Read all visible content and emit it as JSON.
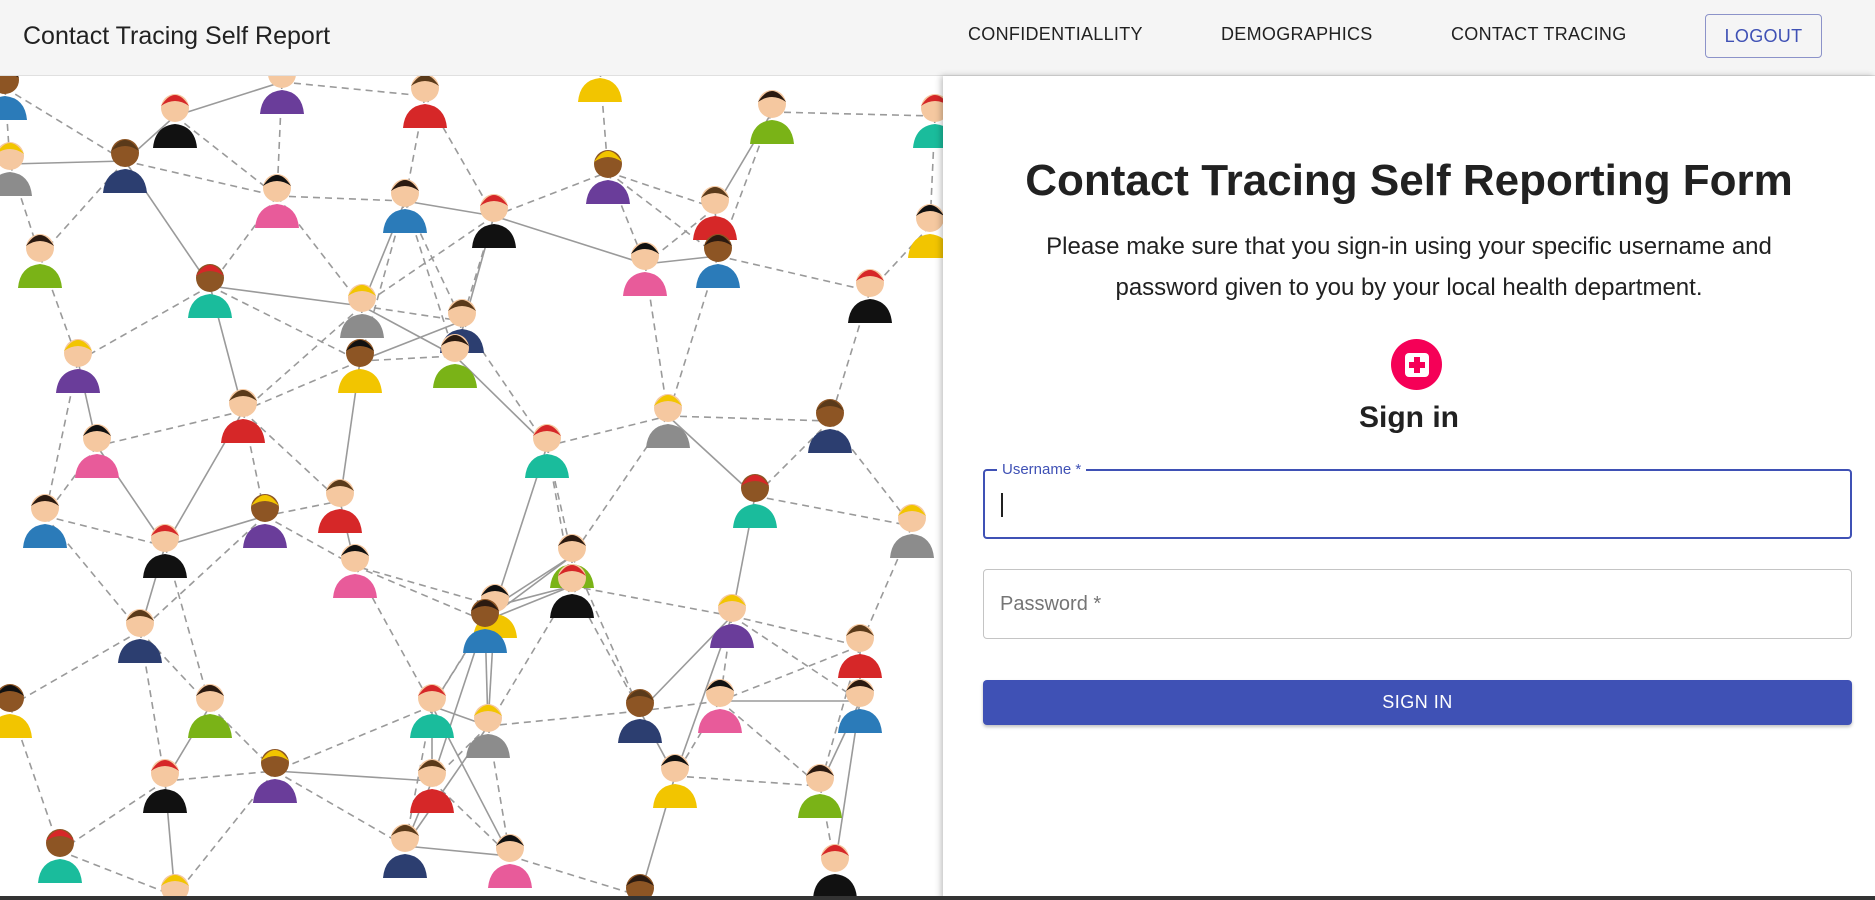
{
  "appbar": {
    "title": "Contact Tracing Self Report",
    "nav": [
      {
        "label": "CONFIDENTIALLITY"
      },
      {
        "label": "DEMOGRAPHICS"
      },
      {
        "label": "CONTACT TRACING"
      }
    ],
    "logout_label": "LOGOUT"
  },
  "form": {
    "title": "Contact Tracing Self Reporting Form",
    "description": "Please make sure that you sign-in using your specific username and password given to you by your local health department.",
    "avatar_icon": "medical-cross-icon",
    "signin_heading": "Sign in",
    "username": {
      "label": "Username *",
      "value": ""
    },
    "password": {
      "placeholder": "Password *",
      "value": ""
    },
    "submit_label": "SIGN IN"
  },
  "colors": {
    "primary": "#3f51b5",
    "accent": "#f50057",
    "appbar_bg": "#f5f5f5"
  },
  "illustration": {
    "subject": "people-network-illustration"
  }
}
